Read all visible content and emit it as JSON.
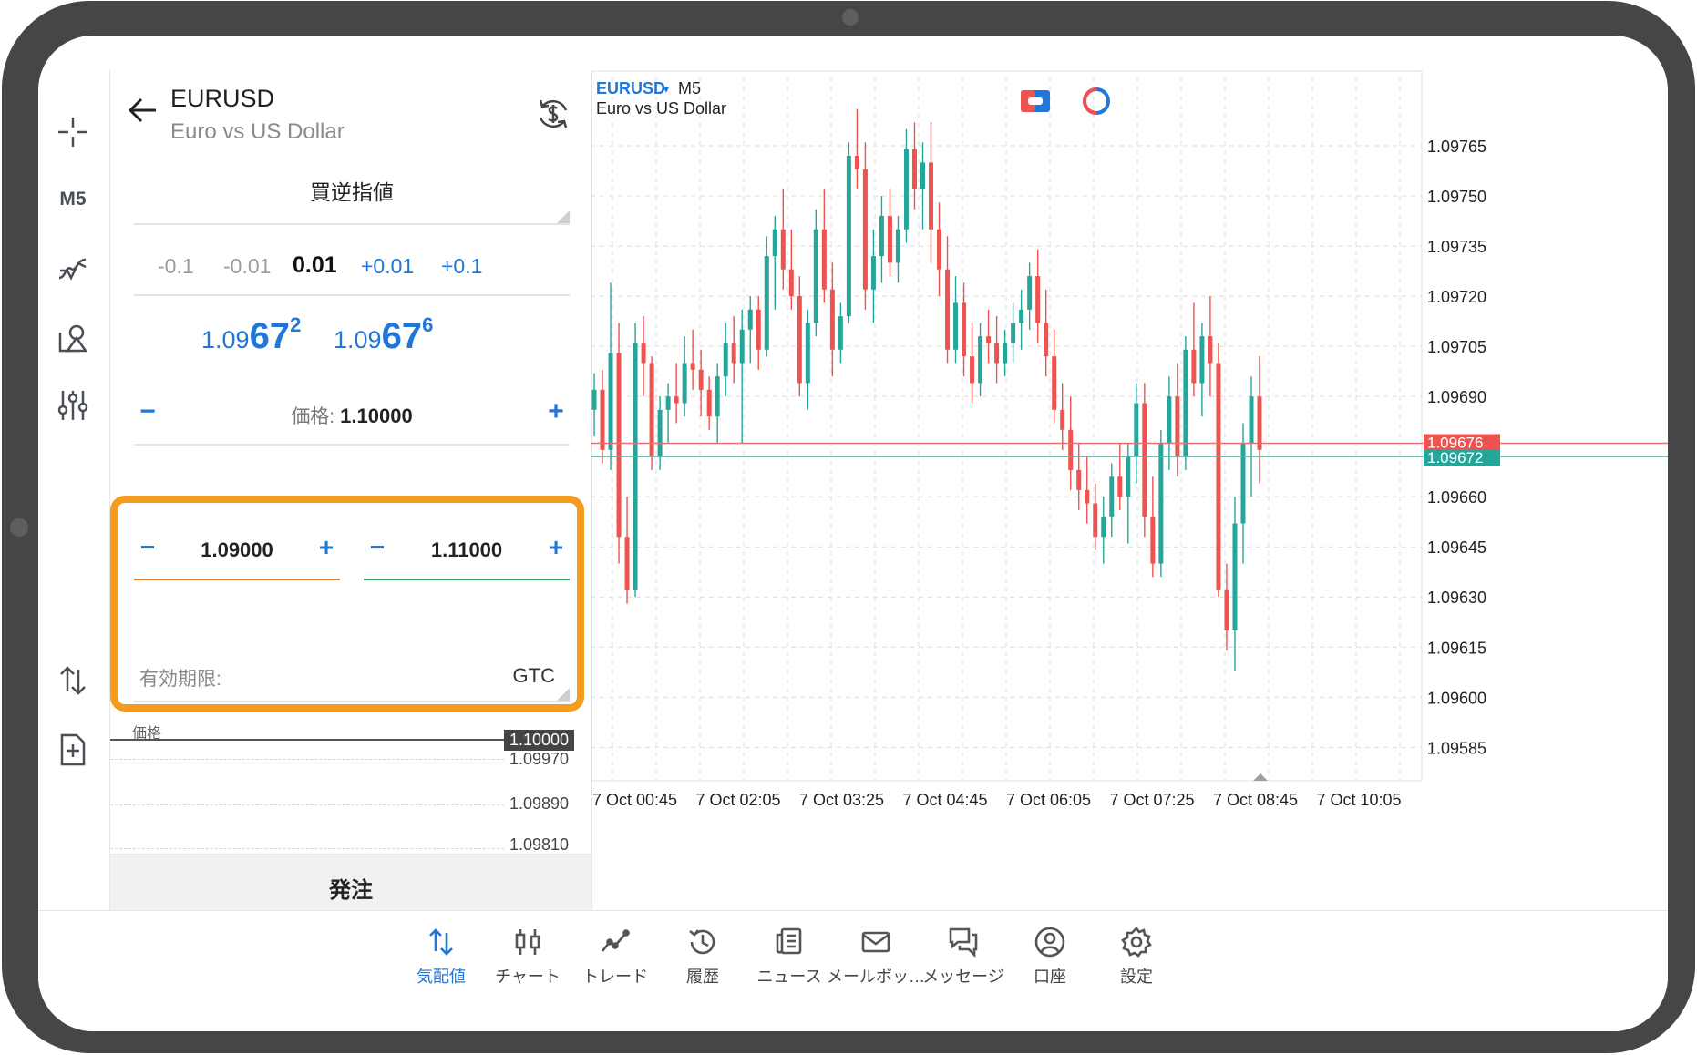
{
  "rail": {
    "timeframe": "M5",
    "icons": [
      "crosshair-icon",
      "indicator-icon",
      "objects-icon",
      "settings-sliders-icon",
      "trade-arrows-icon",
      "new-order-icon"
    ]
  },
  "panel": {
    "symbol": "EURUSD",
    "symbol_desc": "Euro vs US Dollar",
    "order_type": "買逆指値",
    "volume_steps": [
      "-0.1",
      "-0.01",
      "0.01",
      "+0.01",
      "+0.1"
    ],
    "bid": {
      "prefix": "1.09",
      "big": "67",
      "sup": "2"
    },
    "ask": {
      "prefix": "1.09",
      "big": "67",
      "sup": "6"
    },
    "price_label": "価格:",
    "price_value": "1.10000",
    "sl_value": "1.09000",
    "tp_value": "1.11000",
    "expiry_label": "有効期限:",
    "expiry_value": "GTC",
    "mini_caption": "価格",
    "mini_levels": [
      "1.10000",
      "1.09970",
      "1.09890",
      "1.09810"
    ],
    "order_button": "発注",
    "colors": {
      "accent": "#2176d9",
      "highlight": "#f39c1f",
      "sl": "#e07b2d",
      "tp": "#3aa36b"
    }
  },
  "chart": {
    "symbol": "EURUSD",
    "timeframe": "M5",
    "description": "Euro vs US Dollar",
    "y_ticks": [
      "1.09765",
      "1.09750",
      "1.09735",
      "1.09720",
      "1.09705",
      "1.09690",
      "1.09660",
      "1.09645",
      "1.09630",
      "1.09615",
      "1.09600",
      "1.09585"
    ],
    "ask_label": "1.09676",
    "bid_label": "1.09672",
    "x_ticks": [
      "7 Oct 00:45",
      "7 Oct 02:05",
      "7 Oct 03:25",
      "7 Oct 04:45",
      "7 Oct 06:05",
      "7 Oct 07:25",
      "7 Oct 08:45",
      "7 Oct 10:05"
    ],
    "colors": {
      "up": "#26a69a",
      "down": "#ef5350",
      "ask_line": "#e57373",
      "bid_line": "#4db6ac",
      "grid": "#dcdcdc"
    }
  },
  "chart_data": {
    "type": "candlestick",
    "title": "EURUSD M5",
    "subtitle": "Euro vs US Dollar",
    "ylim": [
      1.09575,
      1.0978
    ],
    "x_ticks": [
      "7 Oct 00:45",
      "7 Oct 02:05",
      "7 Oct 03:25",
      "7 Oct 04:45",
      "7 Oct 06:05",
      "7 Oct 07:25",
      "7 Oct 08:45",
      "7 Oct 10:05"
    ],
    "ask": 1.09676,
    "bid": 1.09672,
    "candles": [
      [
        1.09686,
        1.09697,
        1.09678,
        1.09692
      ],
      [
        1.09692,
        1.09698,
        1.0967,
        1.09674
      ],
      [
        1.09674,
        1.09724,
        1.09668,
        1.09703
      ],
      [
        1.09703,
        1.09712,
        1.0964,
        1.09648
      ],
      [
        1.09648,
        1.0966,
        1.09628,
        1.09632
      ],
      [
        1.09632,
        1.09712,
        1.0963,
        1.09706
      ],
      [
        1.09706,
        1.09714,
        1.0969,
        1.097
      ],
      [
        1.097,
        1.09702,
        1.09668,
        1.09672
      ],
      [
        1.09672,
        1.0969,
        1.09668,
        1.09686
      ],
      [
        1.09686,
        1.09694,
        1.09676,
        1.0969
      ],
      [
        1.0969,
        1.097,
        1.09682,
        1.09688
      ],
      [
        1.09688,
        1.09708,
        1.09684,
        1.097
      ],
      [
        1.097,
        1.0971,
        1.09692,
        1.09698
      ],
      [
        1.09698,
        1.09704,
        1.09684,
        1.09692
      ],
      [
        1.09692,
        1.09696,
        1.0968,
        1.09684
      ],
      [
        1.09684,
        1.097,
        1.09676,
        1.09696
      ],
      [
        1.09696,
        1.09712,
        1.0969,
        1.09706
      ],
      [
        1.09706,
        1.09714,
        1.09694,
        1.097
      ],
      [
        1.097,
        1.09716,
        1.09676,
        1.0971
      ],
      [
        1.0971,
        1.0972,
        1.097,
        1.09716
      ],
      [
        1.09716,
        1.0972,
        1.09698,
        1.09704
      ],
      [
        1.09704,
        1.09738,
        1.09702,
        1.09732
      ],
      [
        1.09732,
        1.09744,
        1.09716,
        1.0974
      ],
      [
        1.0974,
        1.09752,
        1.09722,
        1.09728
      ],
      [
        1.09728,
        1.0974,
        1.09716,
        1.0972
      ],
      [
        1.0972,
        1.09726,
        1.0969,
        1.09694
      ],
      [
        1.09694,
        1.09716,
        1.09686,
        1.09712
      ],
      [
        1.09712,
        1.09746,
        1.09708,
        1.0974
      ],
      [
        1.0974,
        1.09752,
        1.09718,
        1.09722
      ],
      [
        1.09722,
        1.0973,
        1.09696,
        1.09704
      ],
      [
        1.09704,
        1.09718,
        1.097,
        1.09714
      ],
      [
        1.09714,
        1.09766,
        1.09712,
        1.09762
      ],
      [
        1.09762,
        1.09776,
        1.09752,
        1.09758
      ],
      [
        1.09758,
        1.09766,
        1.09716,
        1.09722
      ],
      [
        1.09722,
        1.0974,
        1.09712,
        1.09732
      ],
      [
        1.09732,
        1.0975,
        1.09724,
        1.09744
      ],
      [
        1.09744,
        1.09752,
        1.09726,
        1.0973
      ],
      [
        1.0973,
        1.09744,
        1.09724,
        1.0974
      ],
      [
        1.0974,
        1.0977,
        1.09736,
        1.09764
      ],
      [
        1.09764,
        1.09772,
        1.09746,
        1.09752
      ],
      [
        1.09752,
        1.09766,
        1.0974,
        1.0976
      ],
      [
        1.0976,
        1.09772,
        1.0973,
        1.0974
      ],
      [
        1.0974,
        1.09748,
        1.0972,
        1.09728
      ],
      [
        1.09728,
        1.09738,
        1.097,
        1.09704
      ],
      [
        1.09704,
        1.09726,
        1.097,
        1.09718
      ],
      [
        1.09718,
        1.09724,
        1.09696,
        1.09702
      ],
      [
        1.09702,
        1.09712,
        1.09688,
        1.09694
      ],
      [
        1.09694,
        1.09712,
        1.0969,
        1.09708
      ],
      [
        1.09708,
        1.09716,
        1.097,
        1.09706
      ],
      [
        1.09706,
        1.09714,
        1.09694,
        1.097
      ],
      [
        1.097,
        1.0971,
        1.09696,
        1.09706
      ],
      [
        1.09706,
        1.09718,
        1.097,
        1.09712
      ],
      [
        1.09712,
        1.09722,
        1.09704,
        1.09716
      ],
      [
        1.09716,
        1.0973,
        1.0971,
        1.09726
      ],
      [
        1.09726,
        1.09734,
        1.09706,
        1.09712
      ],
      [
        1.09712,
        1.09722,
        1.09696,
        1.09702
      ],
      [
        1.09702,
        1.0971,
        1.09682,
        1.09686
      ],
      [
        1.09686,
        1.09694,
        1.09674,
        1.0968
      ],
      [
        1.0968,
        1.0969,
        1.09662,
        1.09668
      ],
      [
        1.09668,
        1.09676,
        1.09656,
        1.09662
      ],
      [
        1.09662,
        1.09672,
        1.09652,
        1.09658
      ],
      [
        1.09658,
        1.09664,
        1.09644,
        1.09648
      ],
      [
        1.09648,
        1.0966,
        1.0964,
        1.09654
      ],
      [
        1.09654,
        1.0967,
        1.09648,
        1.09666
      ],
      [
        1.09666,
        1.09676,
        1.09656,
        1.0966
      ],
      [
        1.0966,
        1.09676,
        1.09646,
        1.09672
      ],
      [
        1.09672,
        1.09694,
        1.09664,
        1.09688
      ],
      [
        1.09688,
        1.09694,
        1.09648,
        1.09654
      ],
      [
        1.09654,
        1.09666,
        1.09636,
        1.0964
      ],
      [
        1.0964,
        1.0968,
        1.09636,
        1.09676
      ],
      [
        1.09676,
        1.09696,
        1.09668,
        1.0969
      ],
      [
        1.0969,
        1.097,
        1.09666,
        1.09672
      ],
      [
        1.09672,
        1.09708,
        1.09668,
        1.09704
      ],
      [
        1.09704,
        1.09718,
        1.0969,
        1.09694
      ],
      [
        1.09694,
        1.09712,
        1.09684,
        1.09708
      ],
      [
        1.09708,
        1.0972,
        1.0969,
        1.097
      ],
      [
        1.097,
        1.09706,
        1.0963,
        1.09632
      ],
      [
        1.09632,
        1.0964,
        1.09614,
        1.0962
      ],
      [
        1.0962,
        1.0966,
        1.09608,
        1.09652
      ],
      [
        1.09652,
        1.09682,
        1.0964,
        1.09676
      ],
      [
        1.09676,
        1.09696,
        1.0966,
        1.0969
      ],
      [
        1.0969,
        1.09702,
        1.09664,
        1.09674
      ]
    ]
  },
  "nav": [
    {
      "label": "気配値",
      "icon": "quotes-icon",
      "active": true
    },
    {
      "label": "チャート",
      "icon": "chart-icon",
      "active": false
    },
    {
      "label": "トレード",
      "icon": "trade-icon",
      "active": false
    },
    {
      "label": "履歴",
      "icon": "history-icon",
      "active": false
    },
    {
      "label": "ニュース",
      "icon": "news-icon",
      "active": false
    },
    {
      "label": "メールボッ…",
      "icon": "mailbox-icon",
      "active": false
    },
    {
      "label": "メッセージ",
      "icon": "messages-icon",
      "active": false
    },
    {
      "label": "口座",
      "icon": "account-icon",
      "active": false
    },
    {
      "label": "設定",
      "icon": "settings-icon",
      "active": false
    }
  ]
}
